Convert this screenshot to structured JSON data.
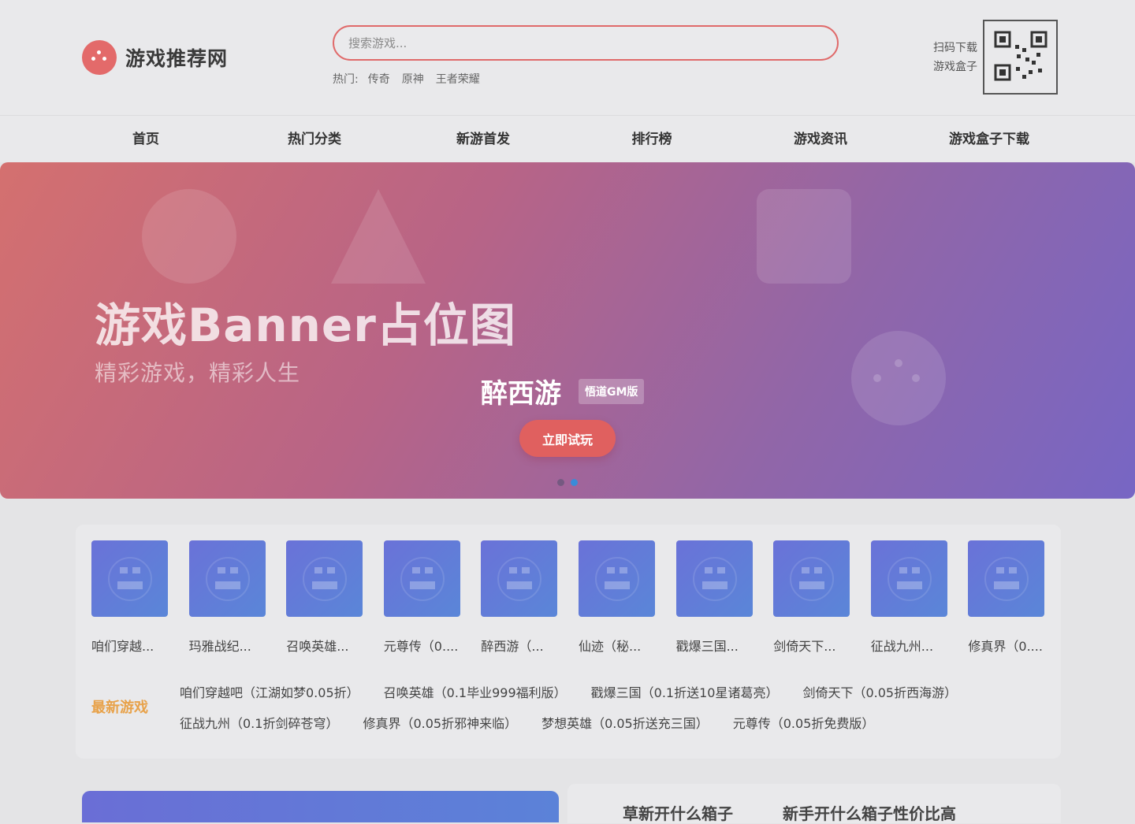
{
  "header": {
    "logo_text": "游戏推荐网",
    "search_placeholder": "搜索游戏...",
    "hot_label": "热门:",
    "hot_links": [
      "传奇",
      "原神",
      "王者荣耀"
    ],
    "qr_line1": "扫码下载",
    "qr_line2": "游戏盒子"
  },
  "nav": {
    "items": [
      "首页",
      "热门分类",
      "新游首发",
      "排行榜",
      "游戏资讯",
      "游戏盒子下载"
    ]
  },
  "banner": {
    "title": "游戏Banner占位图",
    "subtitle": "精彩游戏，精彩人生",
    "game_name": "醉西游",
    "badge": "悟道GM版",
    "button": "立即试玩",
    "dot_count": 2,
    "active_dot": 2
  },
  "games": {
    "cards": [
      "咱们穿越...",
      "玛雅战纪...",
      "召唤英雄...",
      "元尊传（0....",
      "醉西游（...",
      "仙迹（秘...",
      "戳爆三国...",
      "剑倚天下...",
      "征战九州...",
      "修真界（0...."
    ],
    "latest_label": "最新游戏",
    "latest_row1": [
      "咱们穿越吧（江湖如梦0.05折）",
      "召唤英雄（0.1毕业999福利版）",
      "戳爆三国（0.1折送10星诸葛亮）",
      "剑倚天下（0.05折西海游）"
    ],
    "latest_row2": [
      "征战九州（0.1折剑碎苍穹）",
      "修真界（0.05折邪神来临）",
      "梦想英雄（0.05折送充三国）",
      "元尊传（0.05折免费版）"
    ]
  },
  "bottom": {
    "tabs": [
      "草新开什么箱子",
      "新手开什么箱子性价比高"
    ]
  },
  "colors": {
    "accent": "#e0605f",
    "latest_label": "#e8a24a",
    "active_dot": "#3a8bd8"
  }
}
